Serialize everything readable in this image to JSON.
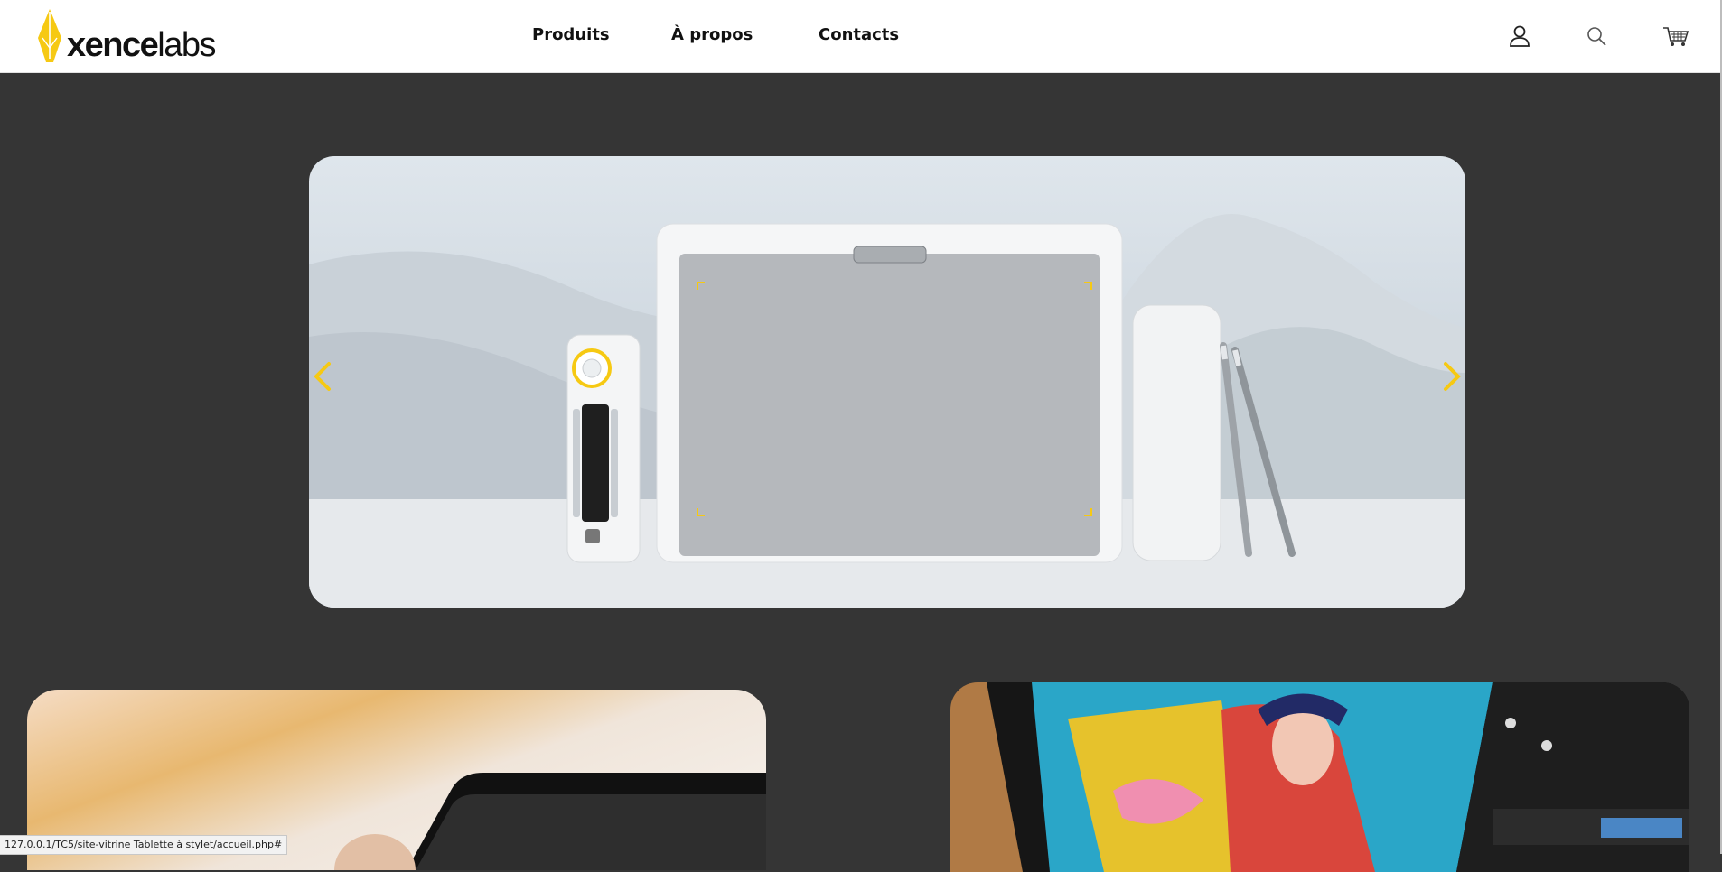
{
  "brand": {
    "name_bold": "xence",
    "name_light": "labs",
    "accent_color": "#f6c913"
  },
  "nav": {
    "items": [
      {
        "label": "Produits"
      },
      {
        "label": "À propos"
      },
      {
        "label": "Contacts"
      }
    ]
  },
  "header_icons": [
    "user-icon",
    "search-icon",
    "cart-icon"
  ],
  "carousel": {
    "image": "Xencelabs pen tablet with quick keys remote, pen case and two pens on snow",
    "prev_icon": "chevron-left-icon",
    "next_icon": "chevron-right-icon",
    "arrow_color": "#f6c913"
  },
  "cards": [
    {
      "image": "hand holding a tablet"
    },
    {
      "image": "pen display showing colorful illustration and video timeline"
    }
  ],
  "status_bar": {
    "url": "127.0.0.1/TC5/site-vitrine Tablette à stylet/accueil.php#"
  }
}
